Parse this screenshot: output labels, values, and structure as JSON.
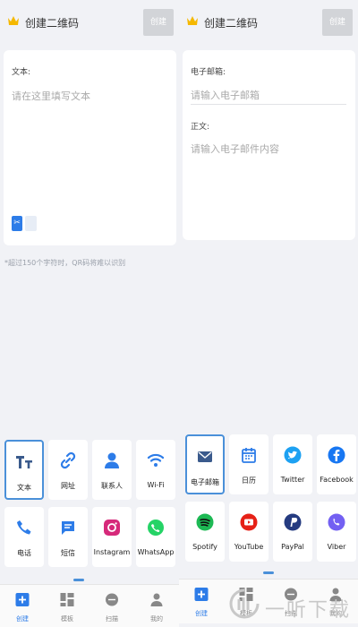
{
  "app": {
    "title": "创建二维码",
    "create_label": "创建"
  },
  "left": {
    "field_label": "文本:",
    "field_placeholder": "请在这里填写文本",
    "hint": "*超过150个字符时，QR码将难以识别",
    "tiles": [
      {
        "label": "文本",
        "icon": "text-icon",
        "selected": true
      },
      {
        "label": "网址",
        "icon": "link-icon"
      },
      {
        "label": "联系人",
        "icon": "contact-icon"
      },
      {
        "label": "Wi-Fi",
        "icon": "wifi-icon"
      },
      {
        "label": "电话",
        "icon": "phone-icon"
      },
      {
        "label": "短信",
        "icon": "sms-icon"
      },
      {
        "label": "Instagram",
        "icon": "instagram-icon"
      },
      {
        "label": "WhatsApp",
        "icon": "whatsapp-icon"
      }
    ]
  },
  "right": {
    "email_label": "电子邮箱:",
    "email_placeholder": "请输入电子邮箱",
    "body_label": "正文:",
    "body_placeholder": "请输入电子邮件内容",
    "tiles": [
      {
        "label": "电子邮箱",
        "icon": "email-icon",
        "selected": true
      },
      {
        "label": "日历",
        "icon": "calendar-icon"
      },
      {
        "label": "Twitter",
        "icon": "twitter-icon"
      },
      {
        "label": "Facebook",
        "icon": "facebook-icon"
      },
      {
        "label": "Spotify",
        "icon": "spotify-icon"
      },
      {
        "label": "YouTube",
        "icon": "youtube-icon"
      },
      {
        "label": "PayPal",
        "icon": "paypal-icon"
      },
      {
        "label": "Viber",
        "icon": "viber-icon"
      }
    ]
  },
  "tabs": [
    {
      "label": "创建",
      "icon": "create-icon",
      "active": true
    },
    {
      "label": "模板",
      "icon": "template-icon"
    },
    {
      "label": "扫描",
      "icon": "scan-icon"
    },
    {
      "label": "我的",
      "icon": "profile-icon"
    }
  ],
  "watermark": {
    "text": "一听下载"
  },
  "colors": {
    "accent": "#2d7ce8",
    "selected_border": "#4a90d9",
    "instagram": "#d6297a",
    "whatsapp": "#25d366",
    "twitter": "#1da1f2",
    "facebook": "#1877f2",
    "spotify": "#1db954",
    "youtube": "#e62117",
    "paypal": "#253b80",
    "viber": "#7360f2"
  }
}
